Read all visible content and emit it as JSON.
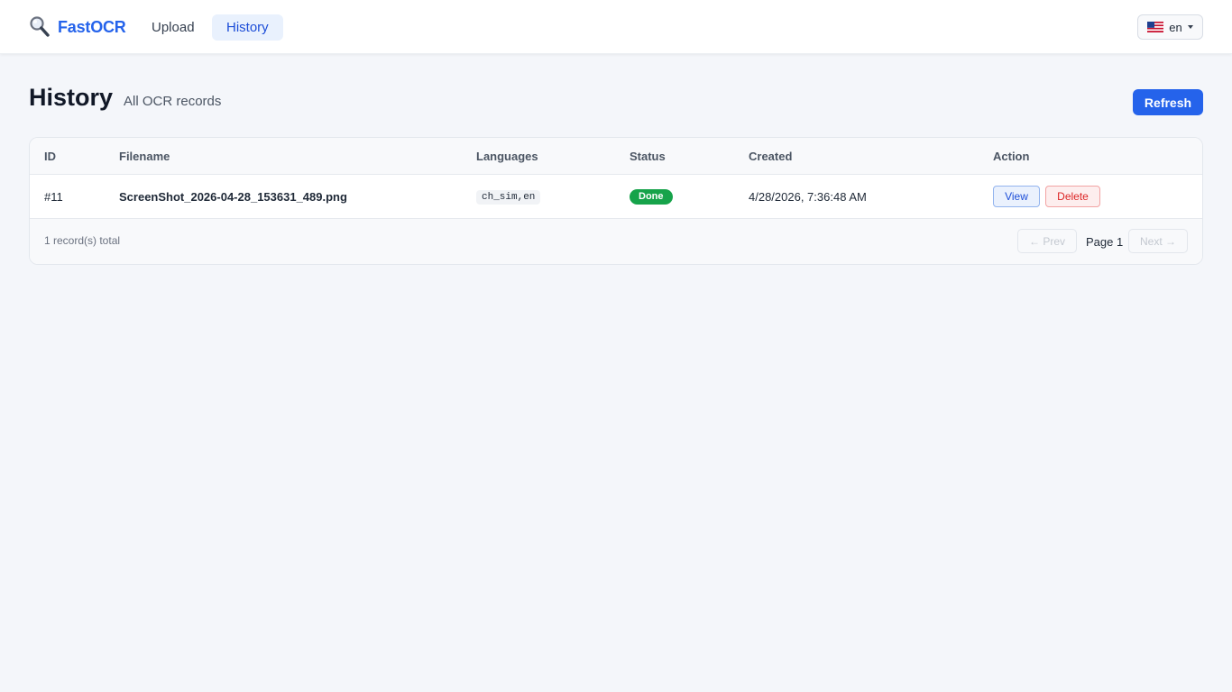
{
  "nav": {
    "brand": "FastOCR",
    "links": [
      "Upload",
      "History"
    ],
    "language": "en",
    "active": "History"
  },
  "header": {
    "title": "History",
    "subtitle": "All OCR records",
    "refresh_label": "Refresh"
  },
  "table": {
    "columns": [
      "ID",
      "Filename",
      "Languages",
      "Status",
      "Created",
      "Action"
    ],
    "rows": [
      {
        "id": "#11",
        "filename": "ScreenShot_2026-04-28_153631_489.png",
        "languages": "ch_sim,en",
        "status": "Done",
        "created": "4/28/2026, 7:36:48 AM",
        "view_label": "View",
        "delete_label": "Delete"
      }
    ]
  },
  "footer": {
    "total": "1 record(s) total",
    "prev_label": "← Prev",
    "page_label": "Page 1",
    "next_label": "Next →"
  },
  "colors": {
    "accent": "#2563eb",
    "success": "#16a34a",
    "danger": "#dc2626",
    "background": "#f4f6fa"
  },
  "icons": {
    "brand": "magnifier-icon",
    "language": "us-flag-icon",
    "dropdown": "caret-down-icon"
  }
}
